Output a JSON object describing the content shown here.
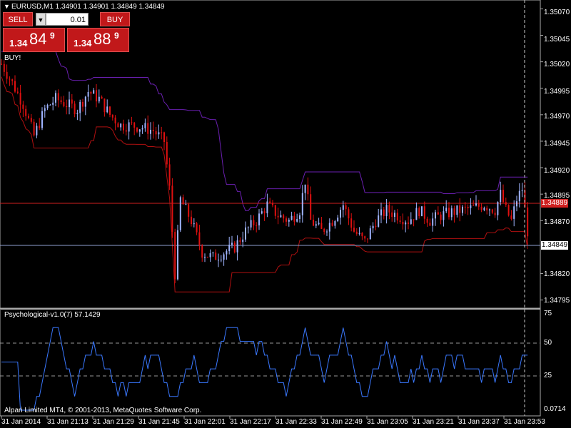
{
  "window": {
    "symbol_line": "EURUSD,M1  1.34901 1.34901 1.34849 1.34849",
    "buy_signal_label": "BUY!",
    "copyright": "Alpari Limited MT4, © 2001-2013, MetaQuotes Software Corp."
  },
  "trade_panel": {
    "sell_label": "SELL",
    "buy_label": "BUY",
    "lot_value": "0.01",
    "sell_quote": {
      "small": "1.34",
      "big": "84",
      "sup": "9"
    },
    "buy_quote": {
      "small": "1.34",
      "big": "88",
      "sup": "9"
    }
  },
  "price_axis": {
    "labels": [
      "1.35070",
      "1.35045",
      "1.35020",
      "1.34995",
      "1.34970",
      "1.34945",
      "1.34920",
      "1.34895",
      "1.34870",
      "1.34820",
      "1.34795"
    ],
    "ask_tag": "1.34889",
    "bid_tag": "1.34849"
  },
  "indicator": {
    "name_line": "Psychological-v1.0(7) 57.1429",
    "levels": [
      "75",
      "50",
      "25",
      "0.0714"
    ]
  },
  "time_axis": {
    "labels": [
      "31 Jan 2014",
      "31 Jan 21:13",
      "31 Jan 21:29",
      "31 Jan 21:45",
      "31 Jan 22:01",
      "31 Jan 22:17",
      "31 Jan 22:33",
      "31 Jan 22:49",
      "31 Jan 23:05",
      "31 Jan 23:21",
      "31 Jan 23:37",
      "31 Jan 23:53"
    ]
  },
  "colors": {
    "bull_candle": "#9fb4ff",
    "bear_candle": "#e01010",
    "upper_channel": "#6a1fb0",
    "lower_channel": "#b01010",
    "ask_line": "#d02020",
    "bid_line": "#8fa0d0",
    "oscillator": "#3a78ff"
  },
  "chart_data": {
    "type": "line",
    "symbol": "EURUSD",
    "timeframe": "M1",
    "ylim": [
      1.3479,
      1.35075
    ],
    "price_series_approx": [
      [
        0,
        1.35018
      ],
      [
        4,
        1.35
      ],
      [
        8,
        1.3498
      ],
      [
        12,
        1.3495
      ],
      [
        16,
        1.34975
      ],
      [
        20,
        1.34985
      ],
      [
        24,
        1.3498
      ],
      [
        28,
        1.34975
      ],
      [
        32,
        1.34992
      ],
      [
        36,
        1.34985
      ],
      [
        40,
        1.3497
      ],
      [
        44,
        1.3496
      ],
      [
        48,
        1.3496
      ],
      [
        52,
        1.34958
      ],
      [
        56,
        1.34955
      ],
      [
        60,
        1.34945
      ],
      [
        62,
        1.349
      ],
      [
        64,
        1.3482
      ],
      [
        66,
        1.3489
      ],
      [
        68,
        1.3488
      ],
      [
        70,
        1.3487
      ],
      [
        74,
        1.3484
      ],
      [
        78,
        1.34835
      ],
      [
        82,
        1.3484
      ],
      [
        86,
        1.34845
      ],
      [
        90,
        1.3486
      ],
      [
        94,
        1.3487
      ],
      [
        98,
        1.34885
      ],
      [
        102,
        1.34875
      ],
      [
        106,
        1.3487
      ],
      [
        110,
        1.3488
      ],
      [
        112,
        1.34908
      ],
      [
        114,
        1.3487
      ],
      [
        118,
        1.3486
      ],
      [
        122,
        1.3487
      ],
      [
        126,
        1.34885
      ],
      [
        130,
        1.3486
      ],
      [
        134,
        1.3485
      ],
      [
        138,
        1.3487
      ],
      [
        142,
        1.3488
      ],
      [
        146,
        1.34875
      ],
      [
        150,
        1.3487
      ],
      [
        154,
        1.3488
      ],
      [
        158,
        1.3487
      ],
      [
        162,
        1.34875
      ],
      [
        166,
        1.34878
      ],
      [
        170,
        1.3488
      ],
      [
        174,
        1.34882
      ],
      [
        178,
        1.34885
      ],
      [
        182,
        1.3488
      ],
      [
        184,
        1.34895
      ],
      [
        186,
        1.3488
      ],
      [
        188,
        1.3487
      ],
      [
        190,
        1.3489
      ],
      [
        192,
        1.349
      ],
      [
        194,
        1.3486
      ]
    ],
    "oscillator_levels": [
      75,
      50,
      25
    ],
    "oscillator_current": 57.1429
  }
}
